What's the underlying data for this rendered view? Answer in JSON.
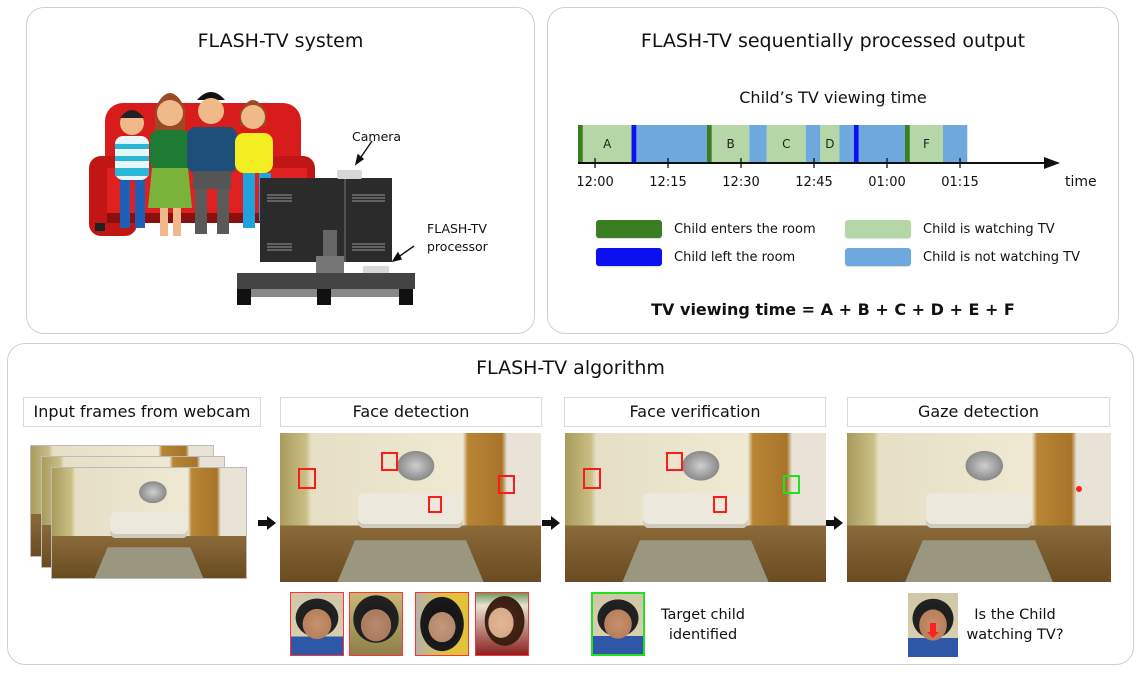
{
  "system_panel": {
    "title": "FLASH-TV system",
    "camera_label": "Camera",
    "processor_label_line1": "FLASH-TV",
    "processor_label_line2": "processor"
  },
  "output_panel": {
    "title": "FLASH-TV sequentially processed output",
    "timeline_title": "Child’s TV viewing time",
    "axis_label": "time",
    "legend": [
      {
        "label": "Child enters the room",
        "color": "#3a7d22"
      },
      {
        "label": "Child left the room",
        "color": "#0a10f0"
      },
      {
        "label": "Child is watching TV",
        "color": "#b5d7a8"
      },
      {
        "label": "Child is not watching TV",
        "color": "#6fa8dc"
      }
    ],
    "formula": "TV viewing time = A + B + C + D + E + F"
  },
  "chart_data": {
    "type": "timeline",
    "title": "Child’s TV viewing time",
    "xlabel": "time",
    "ticks": [
      "12:00",
      "12:15",
      "12:30",
      "12:45",
      "01:00",
      "01:15"
    ],
    "tick_minutes": [
      0,
      15,
      30,
      45,
      60,
      75
    ],
    "xlim_minutes": [
      -3.5,
      90
    ],
    "segments": [
      {
        "start": -3.5,
        "end": -2.5,
        "state": "enter",
        "label": ""
      },
      {
        "start": -2.5,
        "end": 7.5,
        "state": "watching",
        "label": "A"
      },
      {
        "start": 7.5,
        "end": 8.5,
        "state": "left",
        "label": ""
      },
      {
        "start": 8.5,
        "end": 23,
        "state": "not_watching",
        "label": ""
      },
      {
        "start": 23,
        "end": 24,
        "state": "enter",
        "label": ""
      },
      {
        "start": 24,
        "end": 31.7,
        "state": "watching",
        "label": "B"
      },
      {
        "start": 31.7,
        "end": 35.3,
        "state": "not_watching",
        "label": ""
      },
      {
        "start": 35.3,
        "end": 43.3,
        "state": "watching",
        "label": "C"
      },
      {
        "start": 43.3,
        "end": 46.3,
        "state": "not_watching",
        "label": ""
      },
      {
        "start": 46.3,
        "end": 50.2,
        "state": "watching",
        "label": "D"
      },
      {
        "start": 50.2,
        "end": 53.2,
        "state": "not_watching",
        "label": ""
      },
      {
        "start": 53.2,
        "end": 54.2,
        "state": "left",
        "label": ""
      },
      {
        "start": 54.2,
        "end": 63.7,
        "state": "not_watching",
        "label": ""
      },
      {
        "start": 63.7,
        "end": 64.7,
        "state": "enter",
        "label": ""
      },
      {
        "start": 64.7,
        "end": 71.5,
        "state": "watching",
        "label": "F"
      },
      {
        "start": 71.5,
        "end": 76.5,
        "state": "not_watching",
        "label": ""
      }
    ],
    "state_colors": {
      "enter": "#3a7d22",
      "left": "#0a10f0",
      "watching": "#b5d7a8",
      "not_watching": "#6fa8dc"
    }
  },
  "algorithm_panel": {
    "title": "FLASH-TV algorithm",
    "steps": [
      {
        "label": "Input frames from webcam"
      },
      {
        "label": "Face detection"
      },
      {
        "label": "Face verification"
      },
      {
        "label": "Gaze detection"
      }
    ],
    "verification_caption_line1": "Target child",
    "verification_caption_line2": "identified",
    "gaze_caption_line1": "Is the Child",
    "gaze_caption_line2": "watching TV?",
    "detection_box_color": "#ff1a1a",
    "target_box_color": "#22e022"
  }
}
